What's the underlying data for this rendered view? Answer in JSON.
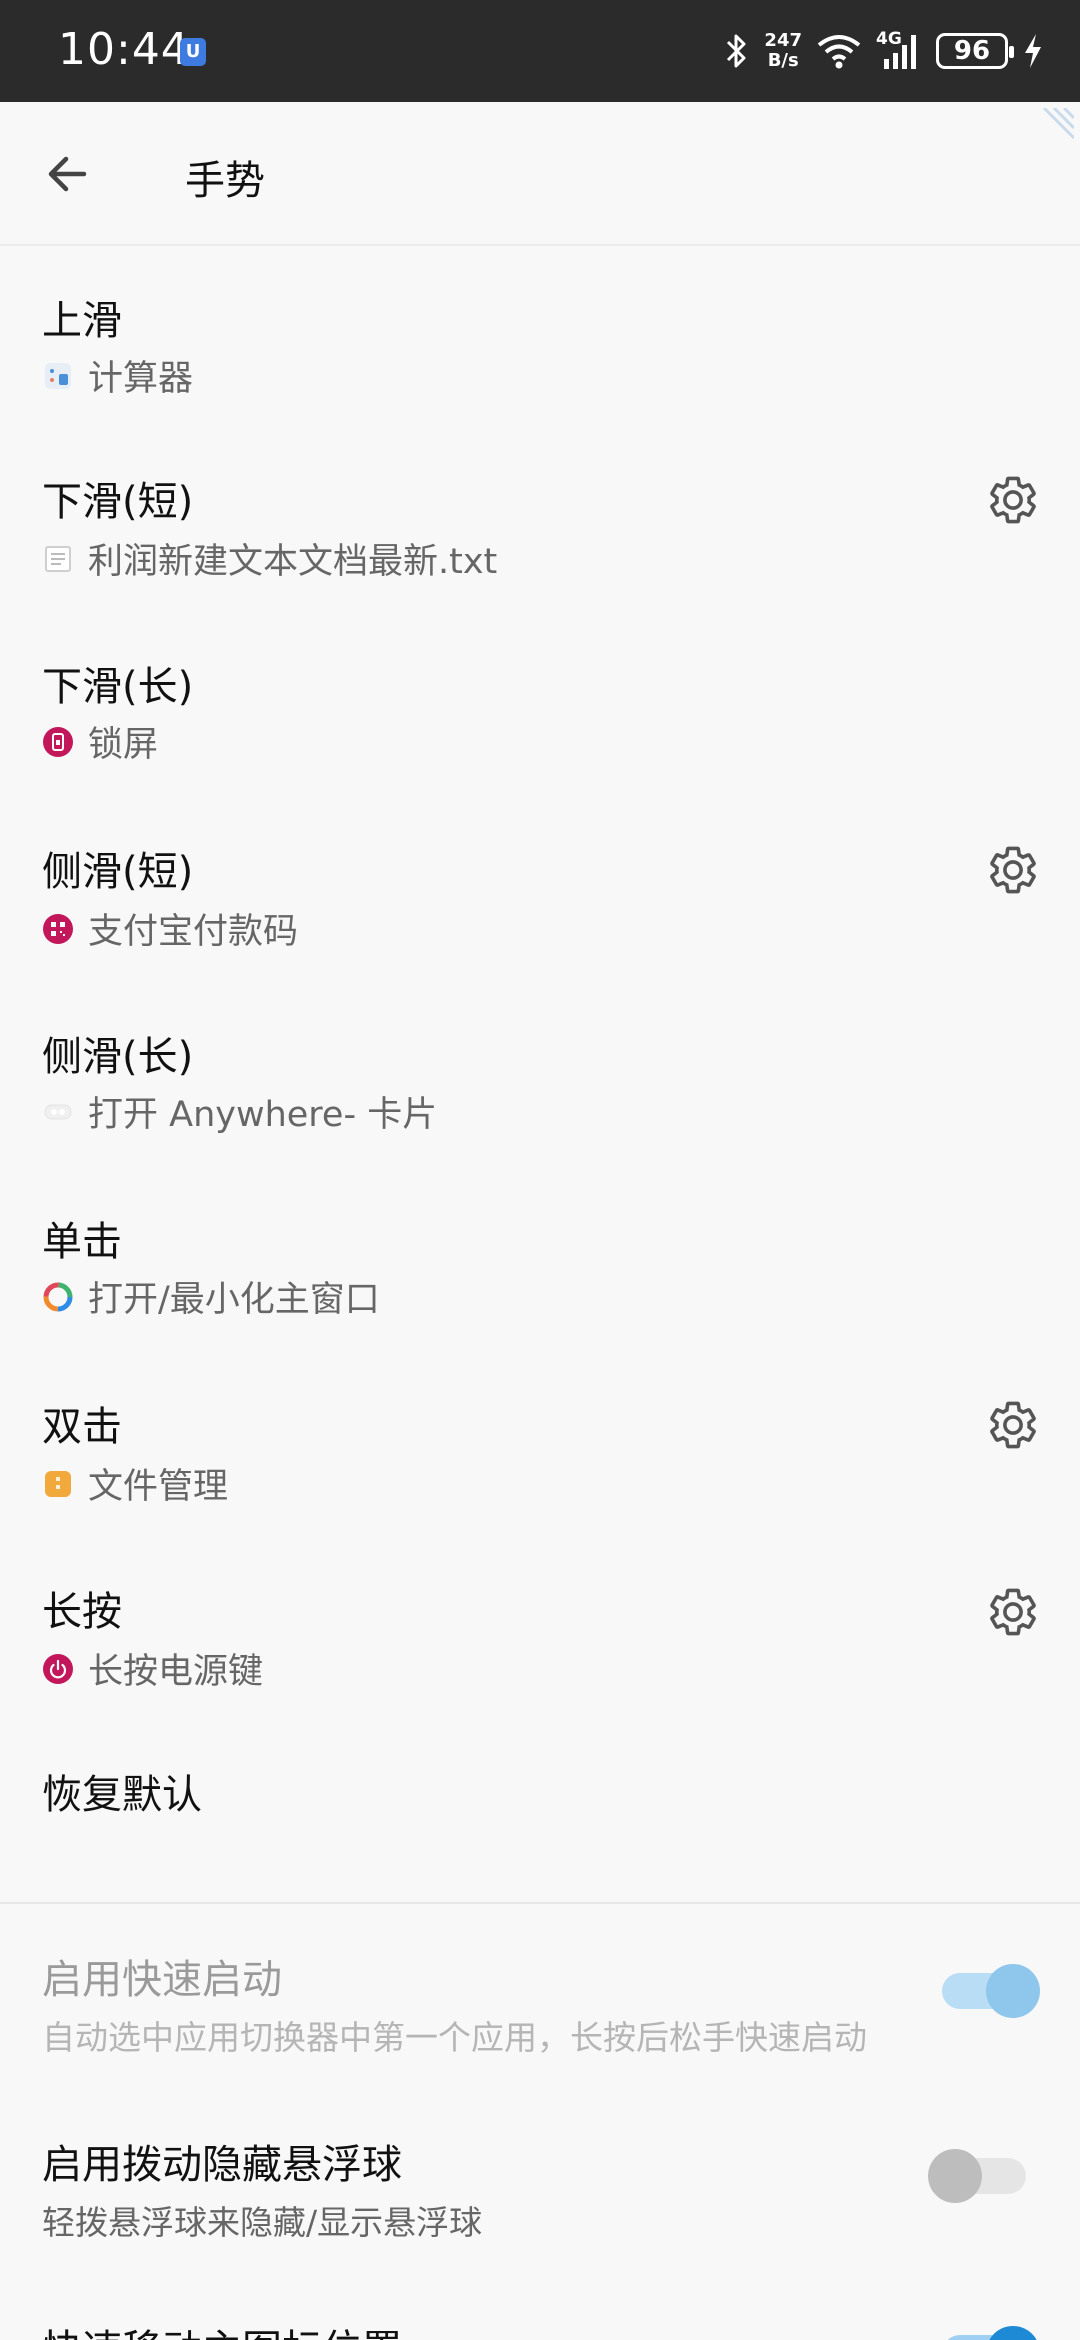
{
  "status_bar": {
    "time": "10:44",
    "speed_top": "247",
    "speed_bottom": "B/s",
    "network": "4G",
    "battery": "96"
  },
  "appbar": {
    "title": "手势"
  },
  "gestures": [
    {
      "title": "上滑",
      "action": "计算器",
      "icon": "calculator-icon",
      "has_settings": false
    },
    {
      "title": "下滑(短)",
      "action": "利润新建文本文档最新.txt",
      "icon": "text-file-icon",
      "has_settings": true
    },
    {
      "title": "下滑(长)",
      "action": "锁屏",
      "icon": "lock-screen-icon",
      "has_settings": false
    },
    {
      "title": "侧滑(短)",
      "action": "支付宝付款码",
      "icon": "payment-code-icon",
      "has_settings": true
    },
    {
      "title": "侧滑(长)",
      "action": "打开 Anywhere- 卡片",
      "icon": "anywhere-card-icon",
      "has_settings": false
    },
    {
      "title": "单击",
      "action": "打开/最小化主窗口",
      "icon": "main-window-icon",
      "has_settings": false
    },
    {
      "title": "双击",
      "action": "文件管理",
      "icon": "file-manager-icon",
      "has_settings": true
    },
    {
      "title": "长按",
      "action": "长按电源键",
      "icon": "power-icon",
      "has_settings": true
    }
  ],
  "restore_default": "恢复默认",
  "options": [
    {
      "title": "启用快速启动",
      "description": "自动选中应用切换器中第一个应用，长按后松手快速启动",
      "enabled": false,
      "checked": true
    },
    {
      "title": "启用拨动隐藏悬浮球",
      "description": "轻拨悬浮球来隐藏/显示悬浮球",
      "enabled": true,
      "checked": false
    },
    {
      "title": "快速移动主图标位置",
      "description": "",
      "enabled": true,
      "checked": true
    }
  ],
  "colors": {
    "accent_red": "#c2185b",
    "toggle_on": "#1e8ad6"
  }
}
